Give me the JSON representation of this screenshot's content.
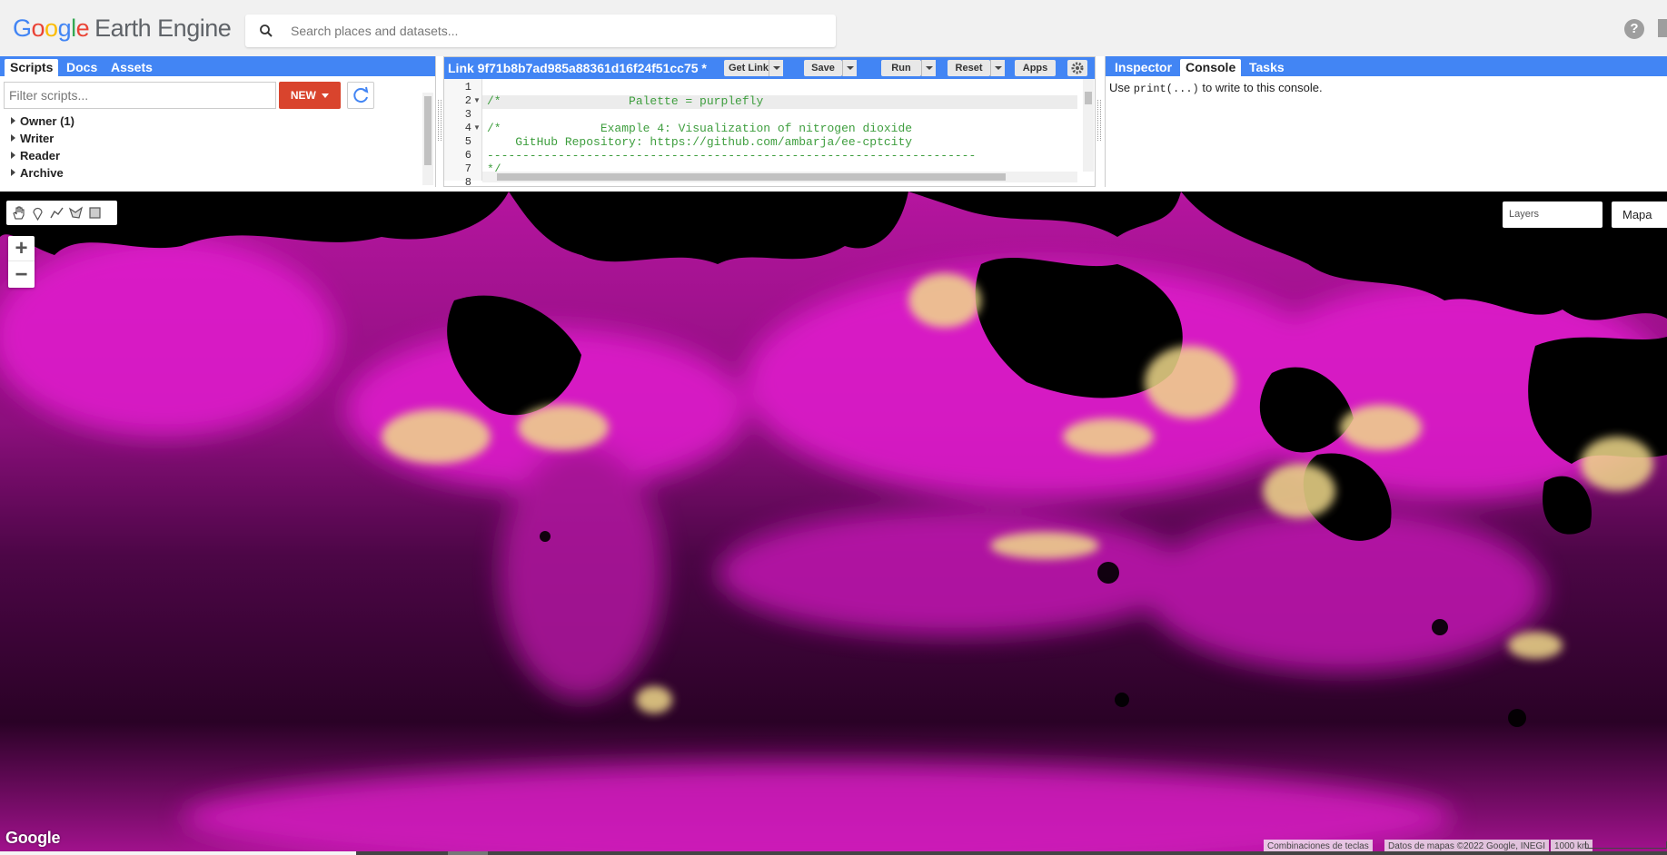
{
  "header": {
    "logo_letters": [
      "G",
      "o",
      "o",
      "g",
      "l",
      "e"
    ],
    "logo_suffix": "Earth Engine",
    "search_placeholder": "Search places and datasets...",
    "help_label": "?"
  },
  "left_panel": {
    "tabs": [
      "Scripts",
      "Docs",
      "Assets"
    ],
    "active_tab": "Scripts",
    "filter_placeholder": "Filter scripts...",
    "new_button": "NEW",
    "tree": [
      "Owner (1)",
      "Writer",
      "Reader",
      "Archive"
    ]
  },
  "editor": {
    "script_name": "Link 9f71b8b7ad985a88361d16f24f51cc75 *",
    "buttons": {
      "get_link": "Get Link",
      "save": "Save",
      "run": "Run",
      "reset": "Reset",
      "apps": "Apps"
    },
    "line_numbers": [
      "1",
      "2",
      "3",
      "4",
      "5",
      "6",
      "7",
      "8"
    ],
    "code_lines": [
      "",
      "/*                  Palette = purplefly",
      "",
      "/*              Example 4: Visualization of nitrogen dioxide",
      "    GitHub Repository: https://github.com/ambarja/ee-cptcity",
      "---------------------------------------------------------------------",
      "*/",
      ""
    ]
  },
  "right_panel": {
    "tabs": [
      "Inspector",
      "Console",
      "Tasks"
    ],
    "active_tab": "Console",
    "console_prefix": "Use ",
    "console_code": "print(...)",
    "console_suffix": " to write to this console."
  },
  "map": {
    "zoom_in": "+",
    "zoom_out": "−",
    "layers_label": "Layers",
    "map_type": "Mapa",
    "google_logo": "Google",
    "attribution_shortcuts": "Combinaciones de teclas",
    "attribution_data": "Datos de mapas ©2022 Google, INEGI",
    "scale": "1000 km",
    "colors": {
      "black": "#000000",
      "magenta": "#e81ad6",
      "dark_purple": "#4a0544",
      "yellow": "#f0d98a"
    }
  }
}
